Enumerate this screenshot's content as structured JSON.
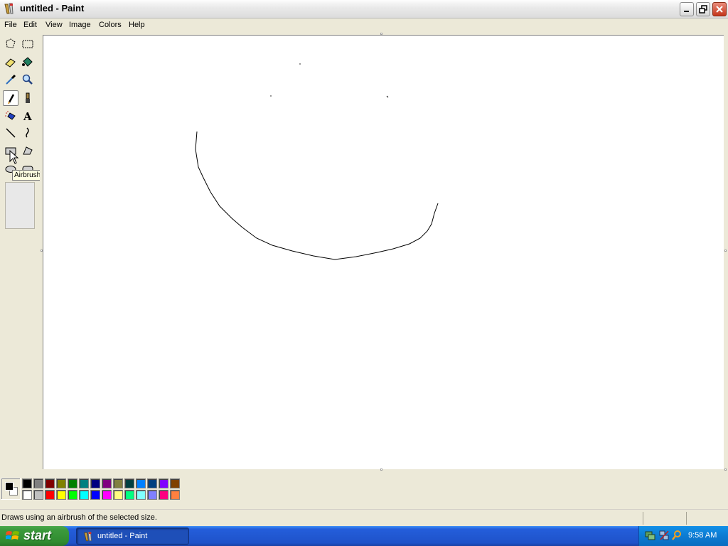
{
  "window": {
    "title": "untitled - Paint"
  },
  "menu": [
    "File",
    "Edit",
    "View",
    "Image",
    "Colors",
    "Help"
  ],
  "tools": [
    {
      "name": "free-form-select-icon"
    },
    {
      "name": "select-icon"
    },
    {
      "name": "eraser-icon"
    },
    {
      "name": "fill-with-color-icon"
    },
    {
      "name": "pick-color-icon"
    },
    {
      "name": "magnifier-icon"
    },
    {
      "name": "pencil-icon"
    },
    {
      "name": "brush-icon"
    },
    {
      "name": "airbrush-icon"
    },
    {
      "name": "text-icon"
    },
    {
      "name": "line-icon"
    },
    {
      "name": "curve-icon"
    },
    {
      "name": "rectangle-icon"
    },
    {
      "name": "polygon-icon"
    },
    {
      "name": "ellipse-icon"
    },
    {
      "name": "rounded-rectangle-icon"
    }
  ],
  "tooltip": "Airbrush",
  "palette": {
    "foreground": "#000000",
    "background": "#ffffff",
    "top_row": [
      "#000000",
      "#808080",
      "#800000",
      "#808000",
      "#008000",
      "#008080",
      "#000080",
      "#800080",
      "#808040",
      "#004040",
      "#0080ff",
      "#004080",
      "#8000ff",
      "#804000"
    ],
    "bottom_row": [
      "#ffffff",
      "#c0c0c0",
      "#ff0000",
      "#ffff00",
      "#00ff00",
      "#00ffff",
      "#0000ff",
      "#ff00ff",
      "#ffff80",
      "#00ff80",
      "#80ffff",
      "#8080ff",
      "#ff0080",
      "#ff8040"
    ]
  },
  "status": {
    "text": "Draws using an airbrush of the selected size."
  },
  "taskbar": {
    "start_label": "start",
    "task_label": "untitled - Paint",
    "clock": "9:58 AM"
  }
}
